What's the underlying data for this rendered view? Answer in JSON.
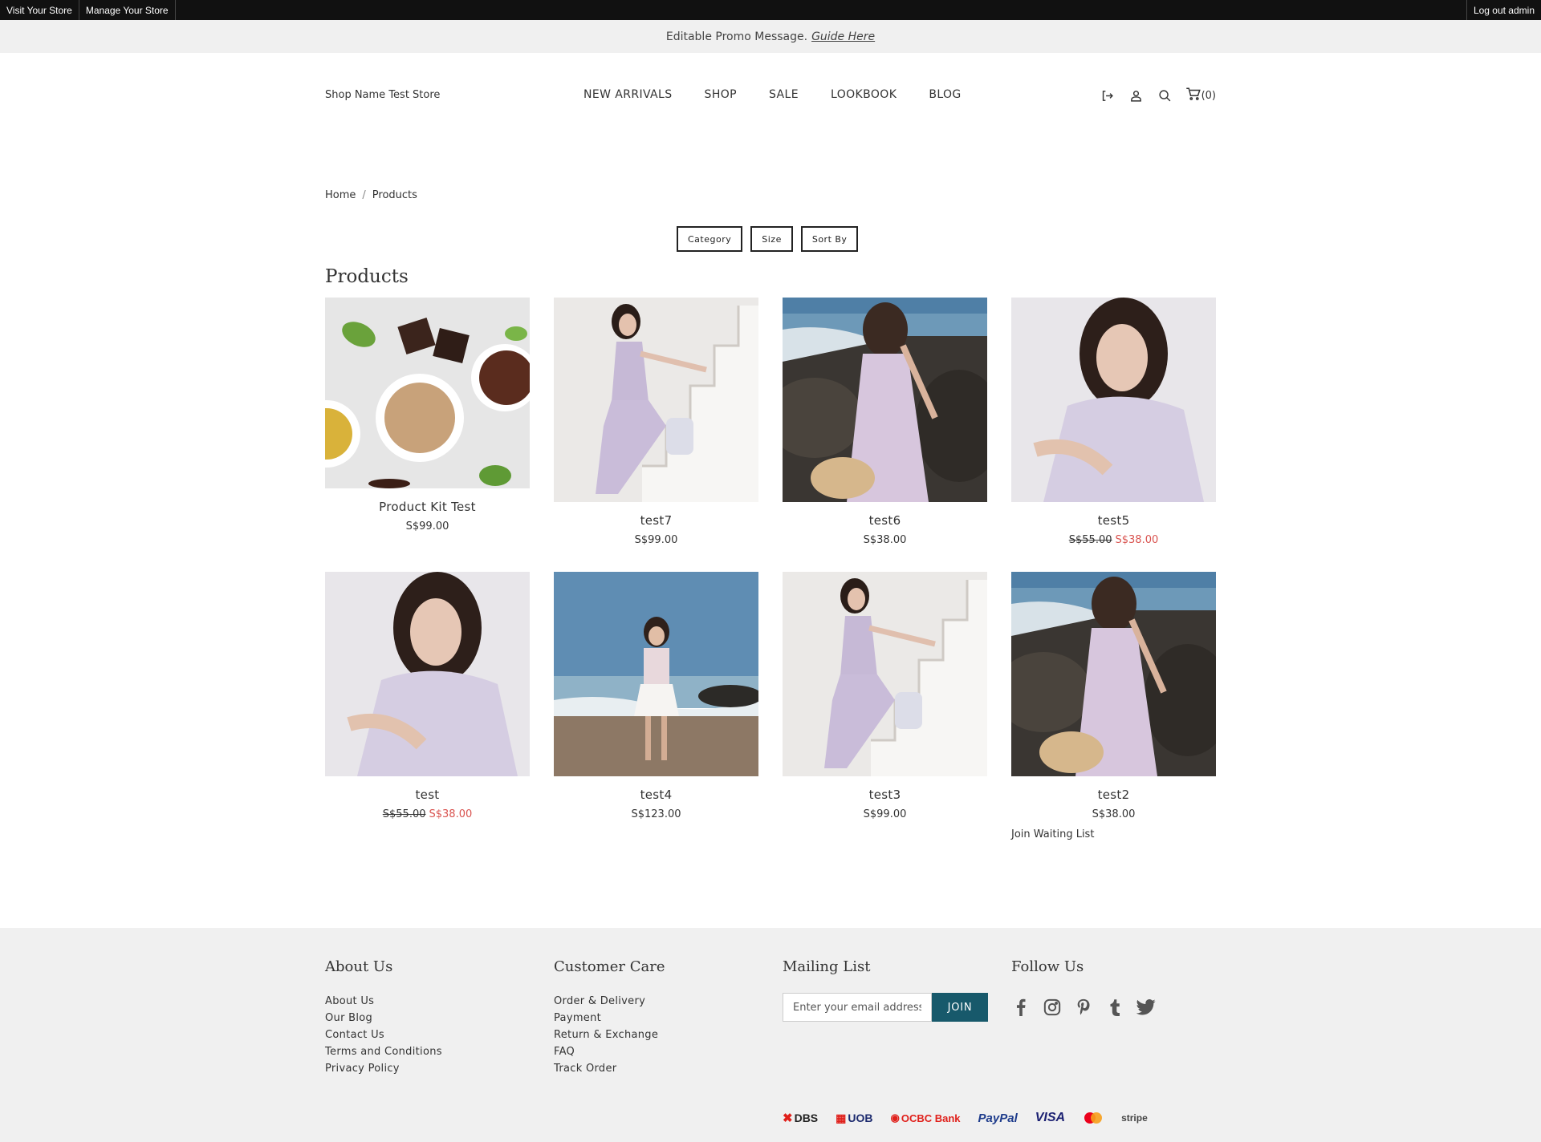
{
  "adminbar": {
    "visit_store": "Visit Your Store",
    "manage_store": "Manage Your Store",
    "logout": "Log out admin"
  },
  "promo": {
    "message": "Editable Promo Message.",
    "guide_link": "Guide Here"
  },
  "header": {
    "shop_name": "Shop Name Test Store",
    "nav": [
      "NEW ARRIVALS",
      "SHOP",
      "SALE",
      "LOOKBOOK",
      "BLOG"
    ],
    "icons": [
      "logout-icon",
      "user-icon",
      "search-icon",
      "cart-icon"
    ],
    "cart_count": "(0)"
  },
  "breadcrumb": {
    "home": "Home",
    "separator": "/",
    "current": "Products"
  },
  "filters": {
    "category": "Category",
    "size": "Size",
    "sort_by": "Sort By"
  },
  "page_title": "Products",
  "products": [
    {
      "name": "Product Kit Test",
      "price": "S$99.00",
      "old_price": "",
      "sale_price": "",
      "image": "ice-cream-chocolate-photo"
    },
    {
      "name": "test7",
      "price": "S$99.00",
      "old_price": "",
      "sale_price": "",
      "image": "woman-on-white-steps-photo"
    },
    {
      "name": "test6",
      "price": "S$38.00",
      "old_price": "",
      "sale_price": "",
      "image": "woman-on-rocks-by-sea-photo"
    },
    {
      "name": "test5",
      "price": "",
      "old_price": "S$55.00",
      "sale_price": "S$38.00",
      "image": "woman-portrait-lilac-top-photo"
    },
    {
      "name": "test",
      "price": "",
      "old_price": "S$55.00",
      "sale_price": "S$38.00",
      "image": "woman-portrait-lilac-top-photo"
    },
    {
      "name": "test4",
      "price": "S$123.00",
      "old_price": "",
      "sale_price": "",
      "image": "woman-on-beach-photo"
    },
    {
      "name": "test3",
      "price": "S$99.00",
      "old_price": "",
      "sale_price": "",
      "image": "woman-on-white-steps-photo"
    },
    {
      "name": "test2",
      "price": "S$38.00",
      "old_price": "",
      "sale_price": "",
      "image": "woman-on-rocks-by-sea-photo",
      "extra": "Join Waiting List"
    }
  ],
  "footer": {
    "about": {
      "heading": "About Us",
      "links": [
        "About Us",
        "Our Blog",
        "Contact Us",
        "Terms and Conditions",
        "Privacy Policy"
      ]
    },
    "care": {
      "heading": "Customer Care",
      "links": [
        "Order & Delivery",
        "Payment",
        "Return & Exchange",
        "FAQ",
        "Track Order"
      ]
    },
    "mailing": {
      "heading": "Mailing List",
      "placeholder": "Enter your email address",
      "button": "JOIN"
    },
    "follow": {
      "heading": "Follow Us",
      "icons": [
        "facebook-icon",
        "instagram-icon",
        "pinterest-icon",
        "tumblr-icon",
        "twitter-icon"
      ]
    },
    "payments": [
      "DBS",
      "UOB",
      "OCBC Bank",
      "PayPal",
      "VISA",
      "mastercard",
      "stripe"
    ]
  },
  "colors": {
    "accent": "#17596b",
    "sale": "#d9534f",
    "admin_bar": "#111111",
    "footer_bg": "#f0f0f0"
  }
}
